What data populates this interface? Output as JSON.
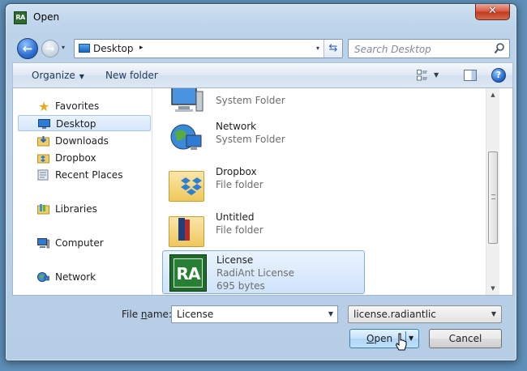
{
  "window": {
    "title": "Open",
    "app_icon_text": "RA",
    "close_label": "✕"
  },
  "nav": {
    "back_label": "←",
    "forward_label": "→",
    "recent_label": "▾"
  },
  "address": {
    "location": "Desktop",
    "separator": "▸",
    "dropdown": "▾",
    "refresh": "⇆"
  },
  "search": {
    "placeholder": "Search Desktop"
  },
  "toolbar": {
    "organize_label": "Organize",
    "organize_caret": "▼",
    "new_folder_label": "New folder",
    "views_dropdown": "▼",
    "help_label": "?"
  },
  "sidebar": {
    "items": [
      {
        "label": "Favorites",
        "icon": "star-icon"
      },
      {
        "label": "Desktop",
        "icon": "desktop-icon",
        "selected": true
      },
      {
        "label": "Downloads",
        "icon": "downloads-icon"
      },
      {
        "label": "Dropbox",
        "icon": "dropbox-icon"
      },
      {
        "label": "Recent Places",
        "icon": "recent-places-icon"
      },
      {
        "label": "Libraries",
        "icon": "libraries-icon"
      },
      {
        "label": "Computer",
        "icon": "computer-icon"
      },
      {
        "label": "Network",
        "icon": "network-icon"
      }
    ]
  },
  "files": {
    "items": [
      {
        "name": "",
        "type": "System Folder",
        "icon": "computer-icon"
      },
      {
        "name": "Network",
        "type": "System Folder",
        "icon": "network-globe-icon"
      },
      {
        "name": "Dropbox",
        "type": "File folder",
        "icon": "dropbox-folder-icon"
      },
      {
        "name": "Untitled",
        "type": "File folder",
        "icon": "folder-icon"
      },
      {
        "name": "License",
        "type": "RadiAnt License",
        "size": "695 bytes",
        "icon": "radiant-license-icon",
        "selected": true
      }
    ],
    "thumb_text": "RA"
  },
  "scrollbar": {
    "up": "▲",
    "down": "▼"
  },
  "footer": {
    "file_name_label_pre": "File ",
    "file_name_label_u": "n",
    "file_name_label_post": "ame:",
    "file_name_value": "License",
    "file_name_dropdown": "▼",
    "filter_value": "license.radiantlic",
    "filter_dropdown": "▼",
    "open_label_u": "O",
    "open_label_rest": "pen",
    "open_dropdown": "▼",
    "cancel_label": "Cancel"
  },
  "colors": {
    "selection": "#cfe3fb",
    "accent": "#3c7fb1"
  }
}
